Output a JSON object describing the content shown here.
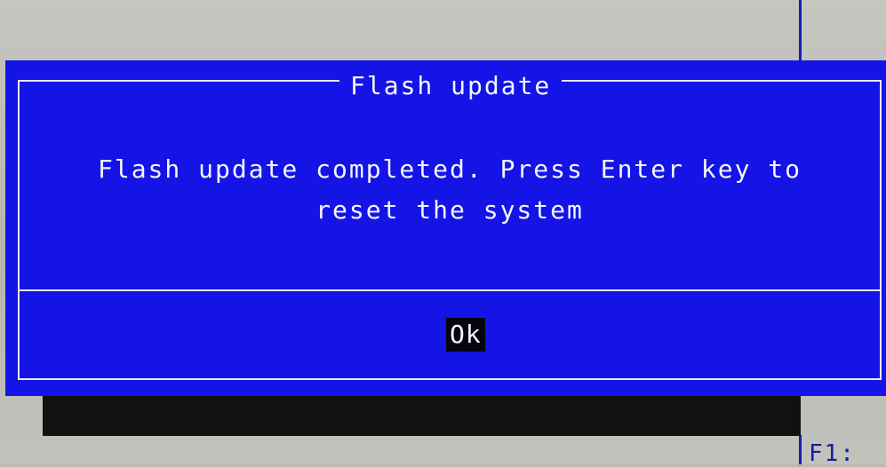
{
  "dialog": {
    "title": "Flash update",
    "message_line1": "Flash update completed. Press Enter key to",
    "message_line2": "reset the system",
    "ok_label": "Ok"
  },
  "background": {
    "help_text": "F1:"
  },
  "colors": {
    "dialog_background": "#1414e6",
    "dialog_text": "#f4f4fa",
    "button_highlight": "#050510",
    "screen_background": "#b9b9b4"
  }
}
